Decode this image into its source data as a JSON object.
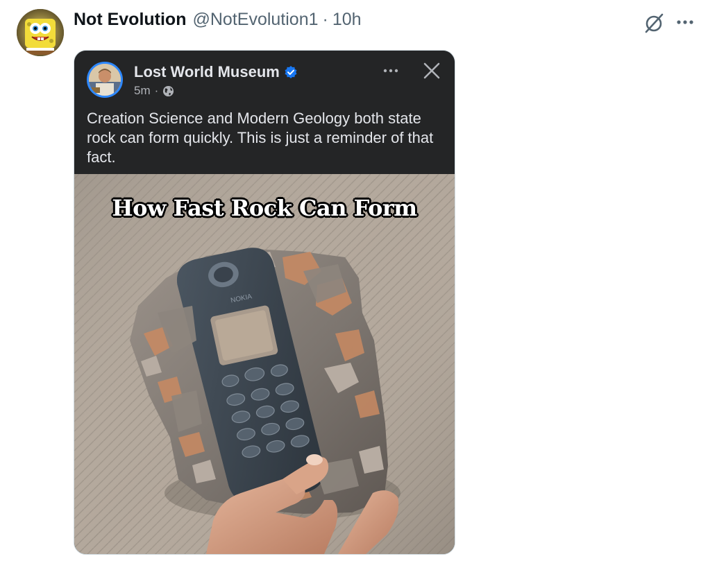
{
  "tweet": {
    "display_name": "Not Evolution",
    "handle": "@NotEvolution1",
    "separator": "·",
    "time": "10h",
    "avatar_icon": "spongebob-imagination-avatar",
    "actions": {
      "grok_icon": "grok-slash-circle-icon",
      "more_icon": "more-horizontal-dots-icon"
    }
  },
  "embedded_post": {
    "page_name": "Lost World Museum",
    "verified_icon": "verified-badge-icon",
    "time": "5m",
    "separator": "·",
    "audience_icon": "globe-public-icon",
    "text": "Creation Science and Modern Geology both state rock can form quickly. This is just a reminder of that fact.",
    "photo": {
      "caption": "How Fast Rock Can Form",
      "brand_on_phone": "NOKIA"
    }
  },
  "colors": {
    "text_primary": "#0f1419",
    "text_secondary": "#536471",
    "fb_background": "#242526",
    "fb_text": "#e4e6eb",
    "fb_meta": "#b0b3b8",
    "verified_blue": "#1877f2"
  }
}
